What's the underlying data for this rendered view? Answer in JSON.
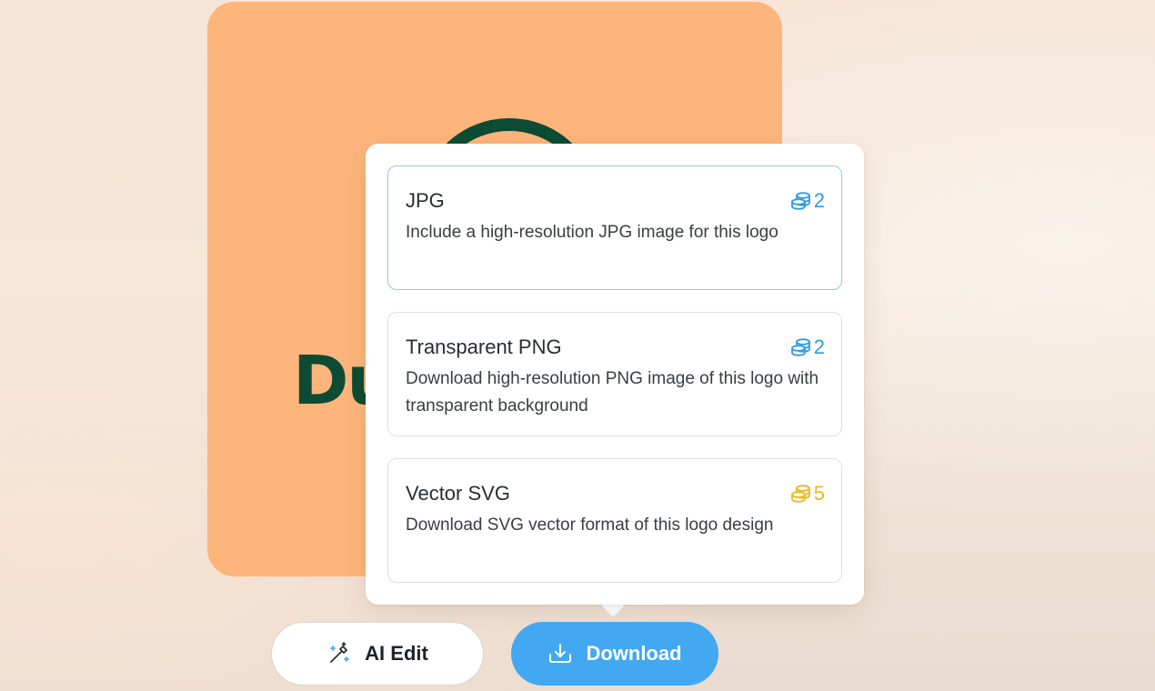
{
  "logo": {
    "wordmark": "Du"
  },
  "download_menu": {
    "options": [
      {
        "title": "JPG",
        "description": "Include a high-resolution JPG image for this logo",
        "cost": "2",
        "cost_icon": "coins-icon",
        "cost_color": "#2f9be6",
        "selected": true
      },
      {
        "title": "Transparent PNG",
        "description": "Download high-resolution PNG image of this logo with transparent background",
        "cost": "2",
        "cost_icon": "coins-icon",
        "cost_color": "#2f9be6",
        "selected": false
      },
      {
        "title": "Vector SVG",
        "description": "Download SVG vector format of this logo design",
        "cost": "5",
        "cost_icon": "coins-icon",
        "cost_color": "#e8b824",
        "selected": false
      }
    ]
  },
  "actions": {
    "ai_edit_label": "AI Edit",
    "ai_edit_icon": "magic-wand-icon",
    "download_label": "Download",
    "download_icon": "download-icon"
  },
  "colors": {
    "logo_background": "#fdb57b",
    "logo_ink": "#0e4b34",
    "primary": "#42a8f2",
    "selected_border": "#8fc9ee"
  }
}
